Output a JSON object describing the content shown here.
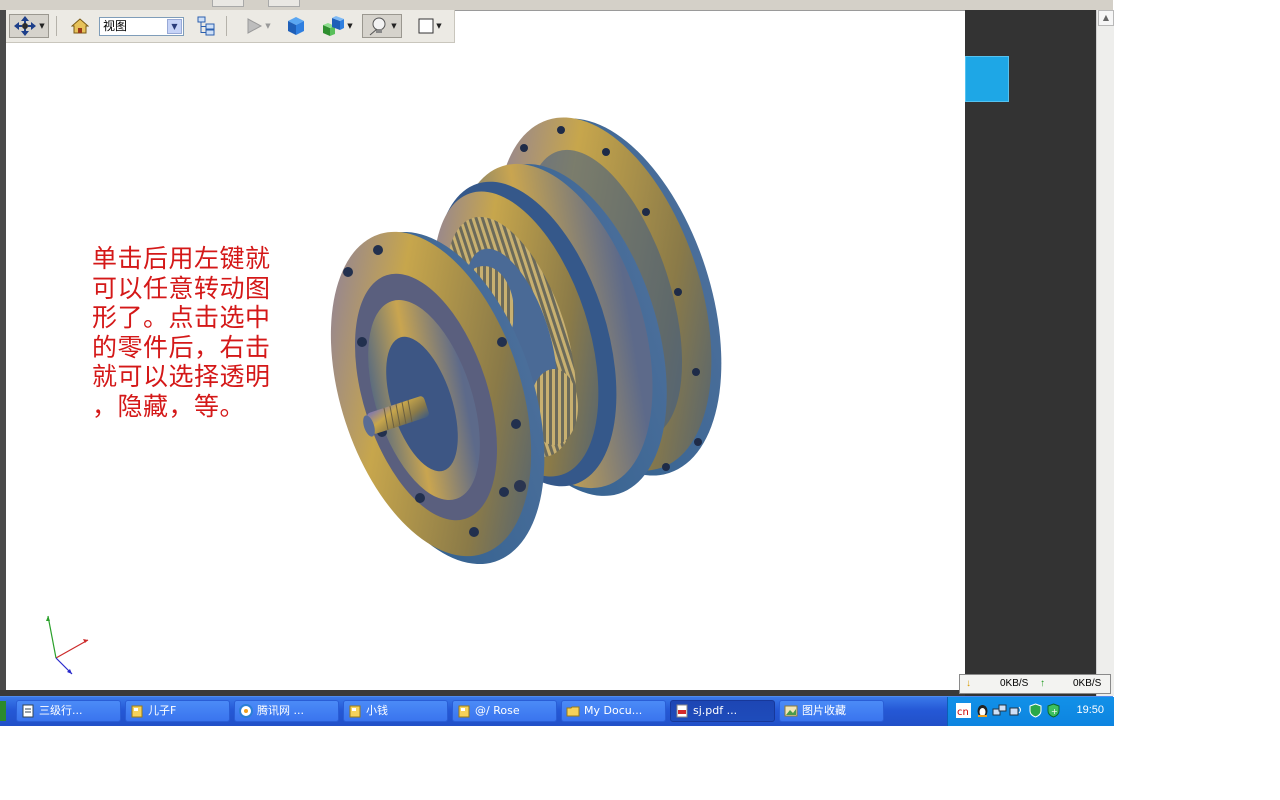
{
  "toolbar": {
    "view_select": "视图"
  },
  "annotation": {
    "lines": [
      "单击后用左键就",
      "可以任意转动图",
      "形了。点击选中",
      "的零件后，右击",
      "就可以选择透明",
      "，隐藏，等。"
    ]
  },
  "network": {
    "download": "0KB/S",
    "upload": "0KB/S"
  },
  "taskbar": {
    "items": [
      {
        "label": "三级行..."
      },
      {
        "label": "儿子F"
      },
      {
        "label": "腾讯网 ..."
      },
      {
        "label": "小钱"
      },
      {
        "label": "@/ Rose"
      },
      {
        "label": "My Docu..."
      },
      {
        "label": "sj.pdf ..."
      },
      {
        "label": "图片收藏"
      }
    ],
    "clock": "19:50"
  },
  "colors": {
    "annotation": "#d41818",
    "taskbar": "#245edb",
    "side_panel": "#333333",
    "side_accent": "#1ea7e6"
  }
}
